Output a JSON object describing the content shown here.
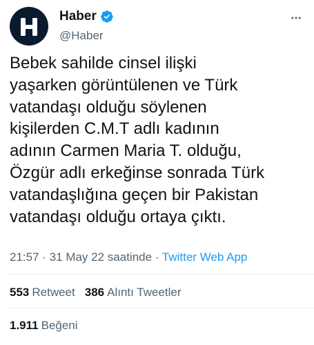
{
  "author": {
    "display_name": "Haber",
    "handle": "@Haber",
    "avatar_letter": "H",
    "avatar_bg": "#0b1b2e",
    "verified": true,
    "verified_color": "#1d9bf0"
  },
  "tweet": {
    "text": "Bebek sahilde cinsel ilişki\nyaşarken görüntülenen ve Türk\nvatandaşı olduğu söylenen\nkişilerden C.M.T adlı kadının\nadının Carmen Maria T. olduğu,\nÖzgür adlı erkeğinse sonrada Türk\nvatandaşlığına geçen bir Pakistan\nvatandaşı olduğu ortaya çıktı.",
    "time": "21:57",
    "separator": "·",
    "date": "31 May 22 saatinde",
    "source": "Twitter Web App"
  },
  "stats": {
    "retweets_count": "553",
    "retweets_label": "Retweet",
    "quotes_count": "386",
    "quotes_label": "Alıntı Tweetler",
    "likes_count": "1.911",
    "likes_label": "Beğeni"
  },
  "icons": {
    "more": "more-horizontal-icon",
    "verified": "verified-badge-icon"
  }
}
